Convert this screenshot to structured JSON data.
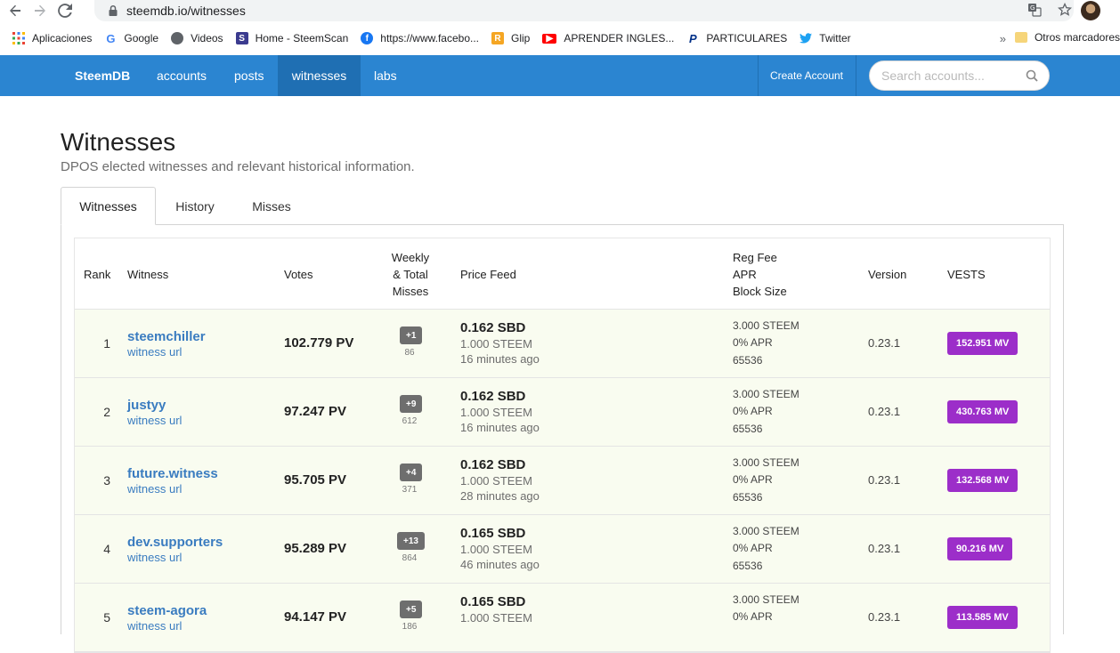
{
  "browser": {
    "url": "steemdb.io/witnesses",
    "bookmarks": [
      {
        "label": "Aplicaciones",
        "icon": "apps-grid-icon",
        "color": "#ea4335"
      },
      {
        "label": "Google",
        "icon": "google-icon",
        "color": "#4285f4"
      },
      {
        "label": "Videos",
        "icon": "globe-icon",
        "color": "#5f6368"
      },
      {
        "label": "Home - SteemScan",
        "icon": "steemscan-icon",
        "color": "#3b3b8f"
      },
      {
        "label": "https://www.facebo...",
        "icon": "facebook-icon",
        "color": "#1877f2"
      },
      {
        "label": "Glip",
        "icon": "glip-icon",
        "color": "#f5a623"
      },
      {
        "label": "APRENDER INGLES...",
        "icon": "youtube-icon",
        "color": "#ff0000"
      },
      {
        "label": "PARTICULARES",
        "icon": "paypal-icon",
        "color": "#003087"
      },
      {
        "label": "Twitter",
        "icon": "twitter-icon",
        "color": "#1da1f2"
      }
    ],
    "more": "»",
    "other_bookmarks": "Otros marcadores"
  },
  "nav": {
    "brand": "SteemDB",
    "links": [
      "accounts",
      "posts",
      "witnesses",
      "labs"
    ],
    "active": "witnesses",
    "create_account": "Create Account",
    "search_placeholder": "Search accounts..."
  },
  "page": {
    "title": "Witnesses",
    "subtitle": "DPOS elected witnesses and relevant historical information."
  },
  "tabs": [
    "Witnesses",
    "History",
    "Misses"
  ],
  "table": {
    "headers": {
      "rank": "Rank",
      "witness": "Witness",
      "votes": "Votes",
      "misses_1": "Weekly",
      "misses_2": "& Total",
      "misses_3": "Misses",
      "price_feed": "Price Feed",
      "fee_1": "Reg Fee",
      "fee_2": "APR",
      "fee_3": "Block Size",
      "version": "Version",
      "vests": "VESTS"
    },
    "rows": [
      {
        "rank": "1",
        "name": "steemchiller",
        "url": "witness url",
        "votes": "102.779 PV",
        "weekly": "+1",
        "total": "86",
        "price": "0.162 SBD",
        "base": "1.000 STEEM",
        "ago": "16 minutes ago",
        "fee": "3.000 STEEM",
        "apr": "0% APR",
        "block": "65536",
        "version": "0.23.1",
        "vests": "152.951 MV"
      },
      {
        "rank": "2",
        "name": "justyy",
        "url": "witness url",
        "votes": "97.247 PV",
        "weekly": "+9",
        "total": "612",
        "price": "0.162 SBD",
        "base": "1.000 STEEM",
        "ago": "16 minutes ago",
        "fee": "3.000 STEEM",
        "apr": "0% APR",
        "block": "65536",
        "version": "0.23.1",
        "vests": "430.763 MV"
      },
      {
        "rank": "3",
        "name": "future.witness",
        "url": "witness url",
        "votes": "95.705 PV",
        "weekly": "+4",
        "total": "371",
        "price": "0.162 SBD",
        "base": "1.000 STEEM",
        "ago": "28 minutes ago",
        "fee": "3.000 STEEM",
        "apr": "0% APR",
        "block": "65536",
        "version": "0.23.1",
        "vests": "132.568 MV"
      },
      {
        "rank": "4",
        "name": "dev.supporters",
        "url": "witness url",
        "votes": "95.289 PV",
        "weekly": "+13",
        "total": "864",
        "price": "0.165 SBD",
        "base": "1.000 STEEM",
        "ago": "46 minutes ago",
        "fee": "3.000 STEEM",
        "apr": "0% APR",
        "block": "65536",
        "version": "0.23.1",
        "vests": "90.216 MV"
      },
      {
        "rank": "5",
        "name": "steem-agora",
        "url": "witness url",
        "votes": "94.147 PV",
        "weekly": "+5",
        "total": "186",
        "price": "0.165 SBD",
        "base": "1.000 STEEM",
        "ago": "",
        "fee": "3.000 STEEM",
        "apr": "0% APR",
        "block": "",
        "version": "0.23.1",
        "vests": "113.585 MV"
      }
    ]
  }
}
